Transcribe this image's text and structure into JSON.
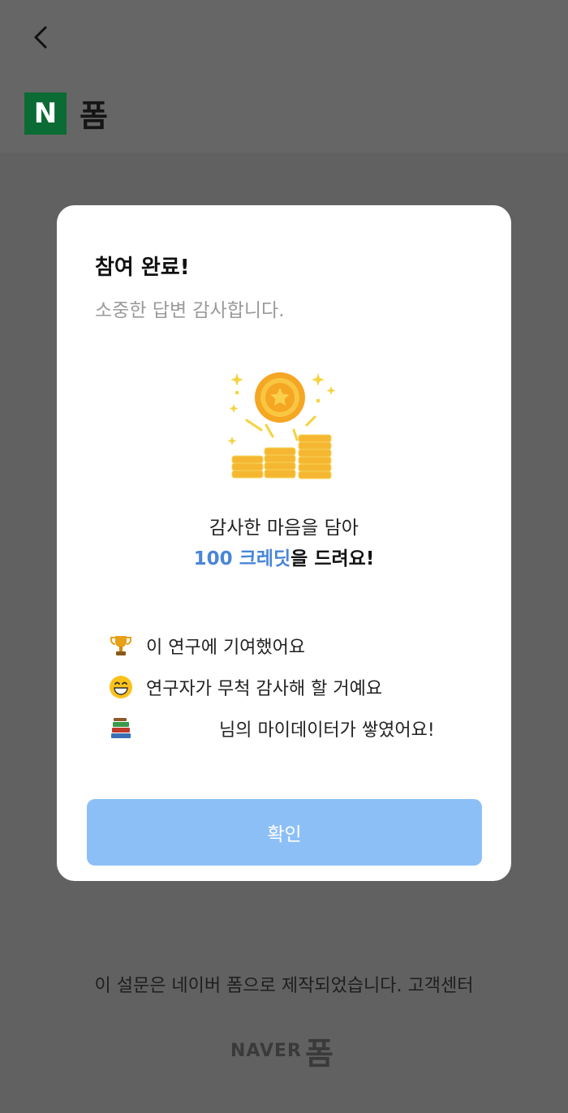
{
  "header": {
    "logo_letter": "N",
    "brand_name": "폼"
  },
  "modal": {
    "title": "참여 완료!",
    "subtitle": "소중한 답변 감사합니다.",
    "message_line1": "감사한 마음을 담아",
    "credit_amount": "100 크레딧",
    "message_line2_suffix": "을 드려요!",
    "benefits": [
      {
        "icon": "trophy-icon",
        "text": "이 연구에 기여했어요"
      },
      {
        "icon": "grinning-face-icon",
        "text": "연구자가 무척 감사해 할 거예요"
      },
      {
        "icon": "books-icon",
        "text": "님의 마이데이터가 쌓였어요!"
      }
    ],
    "confirm_label": "확인"
  },
  "footer": {
    "notice": "이 설문은 네이버 폼으로 제작되었습니다.",
    "support_link": "고객센터",
    "logo_naver": "NAVER",
    "logo_form": "폼"
  },
  "colors": {
    "overlay": "#666666",
    "brand_green": "#0b6b34",
    "credit_blue": "#4a86d8",
    "button_blue": "#8dbff7"
  }
}
